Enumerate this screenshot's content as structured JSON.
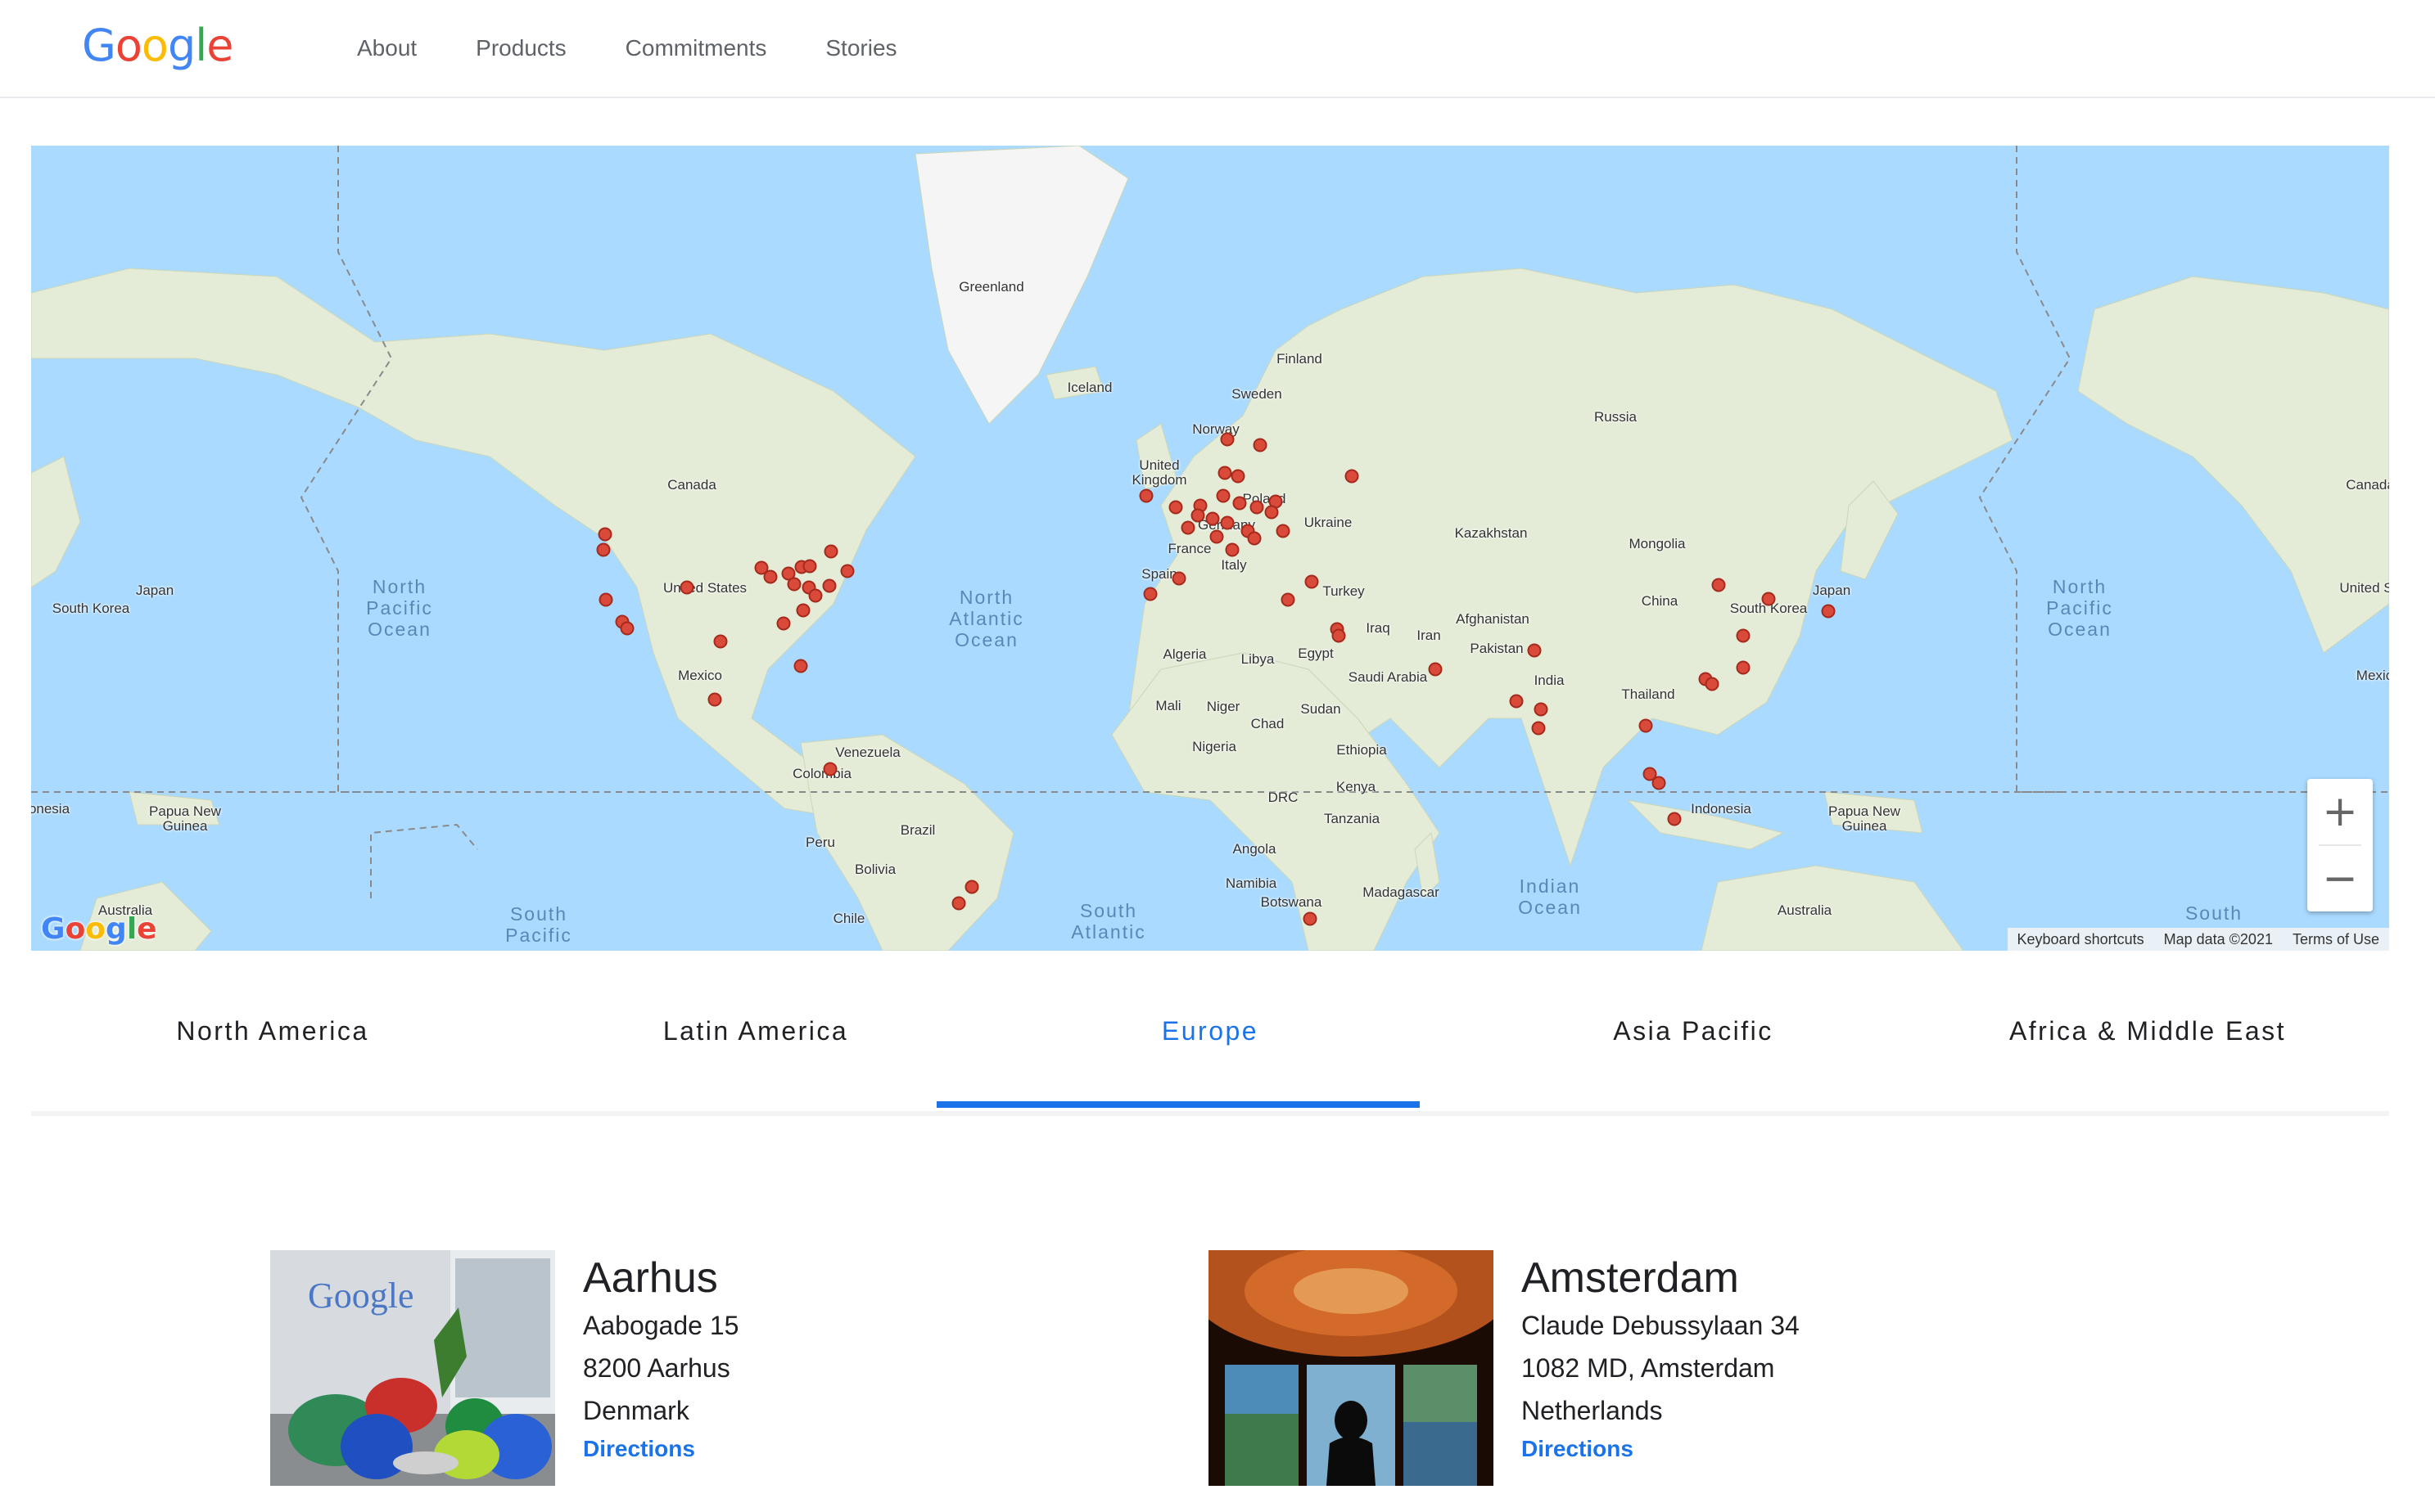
{
  "header": {
    "logo_letters": [
      {
        "char": "G",
        "color": "#4285F4"
      },
      {
        "char": "o",
        "color": "#EA4335"
      },
      {
        "char": "o",
        "color": "#FBBC05"
      },
      {
        "char": "g",
        "color": "#4285F4"
      },
      {
        "char": "l",
        "color": "#34A853"
      },
      {
        "char": "e",
        "color": "#EA4335"
      }
    ],
    "nav": [
      "About",
      "Products",
      "Commitments",
      "Stories"
    ]
  },
  "map": {
    "country_labels": [
      "Greenland",
      "Iceland",
      "Finland",
      "Sweden",
      "Norway",
      "Russia",
      "United Kingdom",
      "Poland",
      "Germany",
      "Ukraine",
      "France",
      "Kazakhstan",
      "Mongolia",
      "Spain",
      "Italy",
      "Turkey",
      "China",
      "Japan",
      "South Korea",
      "Canada",
      "United States",
      "Mexico",
      "Algeria",
      "Libya",
      "Egypt",
      "Iraq",
      "Iran",
      "Afghanistan",
      "Pakistan",
      "India",
      "Saudi Arabia",
      "Thailand",
      "Mali",
      "Niger",
      "Chad",
      "Sudan",
      "Nigeria",
      "Ethiopia",
      "Venezuela",
      "Colombia",
      "Kenya",
      "DRC",
      "Tanzania",
      "Indonesia",
      "Papua New Guinea",
      "Peru",
      "Brazil",
      "Bolivia",
      "Angola",
      "Namibia",
      "Botswana",
      "Madagascar",
      "Chile",
      "Australia",
      "Canada",
      "United S",
      "Mexic",
      "Japan",
      "South Korea",
      "Papua New Guinea",
      "Australia",
      "onesia"
    ],
    "ocean_labels": [
      "North Pacific Ocean",
      "North Atlantic Ocean",
      "North Pacific Ocean",
      "South Pacific",
      "South Atlantic",
      "Indian Ocean",
      "South"
    ],
    "zoom_in": "+",
    "zoom_out": "−",
    "footer": [
      "Keyboard shortcuts",
      "Map data ©2021",
      "Terms of Use"
    ],
    "watermark": "Google"
  },
  "tabs": {
    "items": [
      "North America",
      "Latin America",
      "Europe",
      "Asia Pacific",
      "Africa & Middle East"
    ],
    "active": "Europe"
  },
  "offices": [
    {
      "name": "Aarhus",
      "address": [
        "Aabogade 15",
        "8200 Aarhus",
        "Denmark"
      ],
      "directions": "Directions"
    },
    {
      "name": "Amsterdam",
      "address": [
        "Claude Debussylaan 34",
        "1082 MD, Amsterdam",
        "Netherlands"
      ],
      "directions": "Directions"
    }
  ]
}
